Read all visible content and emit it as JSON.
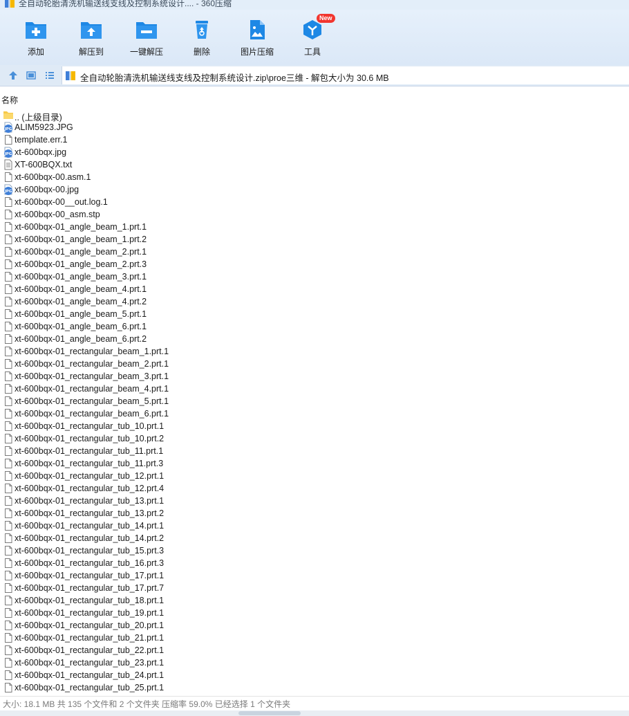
{
  "window": {
    "title": "全自动轮胎清洗机输送线支线及控制系统设计.... - 360压缩"
  },
  "toolbar": {
    "items": [
      {
        "label": "添加",
        "icon": "add-folder-icon"
      },
      {
        "label": "解压到",
        "icon": "extract-folder-icon"
      },
      {
        "label": "一键解压",
        "icon": "one-click-extract-icon"
      },
      {
        "label": "删除",
        "icon": "recycle-bin-icon"
      },
      {
        "label": "图片压缩",
        "icon": "image-compress-icon"
      },
      {
        "label": "工具",
        "icon": "tools-cube-icon",
        "badge": "New"
      }
    ]
  },
  "addressbar": {
    "path": "全自动轮胎清洗机输送线支线及控制系统设计.zip\\proe三维 - 解包大小为 30.6 MB"
  },
  "list": {
    "column_name": "名称",
    "files": [
      {
        "name": ".. (上级目录)",
        "type": "folder"
      },
      {
        "name": "ALIM5923.JPG",
        "type": "jpg"
      },
      {
        "name": "template.err.1",
        "type": "file"
      },
      {
        "name": "xt-600bqx.jpg",
        "type": "jpg"
      },
      {
        "name": "XT-600BQX.txt",
        "type": "txt"
      },
      {
        "name": "xt-600bqx-00.asm.1",
        "type": "file"
      },
      {
        "name": "xt-600bqx-00.jpg",
        "type": "jpg"
      },
      {
        "name": "xt-600bqx-00__out.log.1",
        "type": "file"
      },
      {
        "name": "xt-600bqx-00_asm.stp",
        "type": "file"
      },
      {
        "name": "xt-600bqx-01_angle_beam_1.prt.1",
        "type": "file"
      },
      {
        "name": "xt-600bqx-01_angle_beam_1.prt.2",
        "type": "file"
      },
      {
        "name": "xt-600bqx-01_angle_beam_2.prt.1",
        "type": "file"
      },
      {
        "name": "xt-600bqx-01_angle_beam_2.prt.3",
        "type": "file"
      },
      {
        "name": "xt-600bqx-01_angle_beam_3.prt.1",
        "type": "file"
      },
      {
        "name": "xt-600bqx-01_angle_beam_4.prt.1",
        "type": "file"
      },
      {
        "name": "xt-600bqx-01_angle_beam_4.prt.2",
        "type": "file"
      },
      {
        "name": "xt-600bqx-01_angle_beam_5.prt.1",
        "type": "file"
      },
      {
        "name": "xt-600bqx-01_angle_beam_6.prt.1",
        "type": "file"
      },
      {
        "name": "xt-600bqx-01_angle_beam_6.prt.2",
        "type": "file"
      },
      {
        "name": "xt-600bqx-01_rectangular_beam_1.prt.1",
        "type": "file"
      },
      {
        "name": "xt-600bqx-01_rectangular_beam_2.prt.1",
        "type": "file"
      },
      {
        "name": "xt-600bqx-01_rectangular_beam_3.prt.1",
        "type": "file"
      },
      {
        "name": "xt-600bqx-01_rectangular_beam_4.prt.1",
        "type": "file"
      },
      {
        "name": "xt-600bqx-01_rectangular_beam_5.prt.1",
        "type": "file"
      },
      {
        "name": "xt-600bqx-01_rectangular_beam_6.prt.1",
        "type": "file"
      },
      {
        "name": "xt-600bqx-01_rectangular_tub_10.prt.1",
        "type": "file"
      },
      {
        "name": "xt-600bqx-01_rectangular_tub_10.prt.2",
        "type": "file"
      },
      {
        "name": "xt-600bqx-01_rectangular_tub_11.prt.1",
        "type": "file"
      },
      {
        "name": "xt-600bqx-01_rectangular_tub_11.prt.3",
        "type": "file"
      },
      {
        "name": "xt-600bqx-01_rectangular_tub_12.prt.1",
        "type": "file"
      },
      {
        "name": "xt-600bqx-01_rectangular_tub_12.prt.4",
        "type": "file"
      },
      {
        "name": "xt-600bqx-01_rectangular_tub_13.prt.1",
        "type": "file"
      },
      {
        "name": "xt-600bqx-01_rectangular_tub_13.prt.2",
        "type": "file"
      },
      {
        "name": "xt-600bqx-01_rectangular_tub_14.prt.1",
        "type": "file"
      },
      {
        "name": "xt-600bqx-01_rectangular_tub_14.prt.2",
        "type": "file"
      },
      {
        "name": "xt-600bqx-01_rectangular_tub_15.prt.3",
        "type": "file"
      },
      {
        "name": "xt-600bqx-01_rectangular_tub_16.prt.3",
        "type": "file"
      },
      {
        "name": "xt-600bqx-01_rectangular_tub_17.prt.1",
        "type": "file"
      },
      {
        "name": "xt-600bqx-01_rectangular_tub_17.prt.7",
        "type": "file"
      },
      {
        "name": "xt-600bqx-01_rectangular_tub_18.prt.1",
        "type": "file"
      },
      {
        "name": "xt-600bqx-01_rectangular_tub_19.prt.1",
        "type": "file"
      },
      {
        "name": "xt-600bqx-01_rectangular_tub_20.prt.1",
        "type": "file"
      },
      {
        "name": "xt-600bqx-01_rectangular_tub_21.prt.1",
        "type": "file"
      },
      {
        "name": "xt-600bqx-01_rectangular_tub_22.prt.1",
        "type": "file"
      },
      {
        "name": "xt-600bqx-01_rectangular_tub_23.prt.1",
        "type": "file"
      },
      {
        "name": "xt-600bqx-01_rectangular_tub_24.prt.1",
        "type": "file"
      },
      {
        "name": "xt-600bqx-01_rectangular_tub_25.prt.1",
        "type": "file"
      }
    ]
  },
  "status": {
    "text": "大小: 18.1 MB 共 135 个文件和 2 个文件夹 压缩率 59.0% 已经选择 1 个文件夹"
  },
  "colors": {
    "toolbar_bg": "#e6f0fb",
    "icon_blue": "#1e88e5",
    "badge_red": "#f2362f",
    "status_text": "#7a7a7a"
  }
}
